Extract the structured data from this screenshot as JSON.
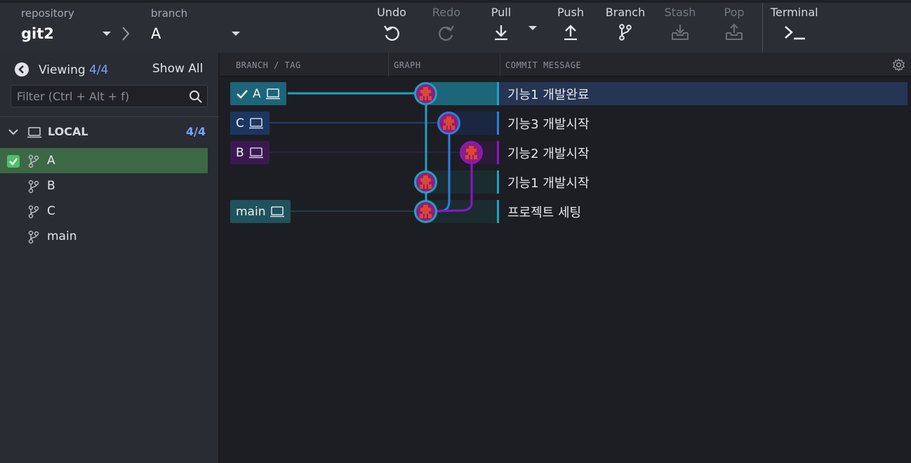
{
  "toolbar": {
    "repository_caption": "repository",
    "repository_name": "git2",
    "branch_caption": "branch",
    "branch_name": "A",
    "buttons": {
      "undo": "Undo",
      "redo": "Redo",
      "pull": "Pull",
      "push": "Push",
      "branch": "Branch",
      "stash": "Stash",
      "pop": "Pop",
      "terminal": "Terminal"
    }
  },
  "left_panel": {
    "viewing_label": "Viewing",
    "viewing_count": "4/4",
    "show_all": "Show All",
    "filter_placeholder": "Filter (Ctrl + Alt + f)",
    "local_label": "LOCAL",
    "local_count": "4/4",
    "branches": [
      {
        "name": "A",
        "checked_out": true
      },
      {
        "name": "B",
        "checked_out": false
      },
      {
        "name": "C",
        "checked_out": false
      },
      {
        "name": "main",
        "checked_out": false
      }
    ]
  },
  "graph": {
    "columns": {
      "branch_tag": "BRANCH / TAG",
      "graph": "GRAPH",
      "commit_message": "COMMIT MESSAGE"
    },
    "commits": [
      {
        "message": "기능1 개발완료",
        "ref": "A",
        "checked_out": true,
        "lane": 0,
        "color": "#1fa0c6",
        "selected": true
      },
      {
        "message": "기능3 개발시작",
        "ref": "C",
        "checked_out": false,
        "lane": 1,
        "color": "#2a7fe0",
        "selected": false
      },
      {
        "message": "기능2 개발시작",
        "ref": "B",
        "checked_out": false,
        "lane": 2,
        "color": "#8e14c9",
        "selected": false
      },
      {
        "message": "기능1 개발시작",
        "ref": "",
        "checked_out": false,
        "lane": 0,
        "color": "#1fa0c6",
        "selected": false
      },
      {
        "message": "프로젝트 세팅",
        "ref": "main",
        "checked_out": false,
        "lane": 0,
        "color": "#1fa0c6",
        "selected": false
      }
    ]
  },
  "colors": {
    "accent_blue": "#7aa2ff",
    "lane_cyan": "#1fa0c6",
    "lane_blue": "#2a7fe0",
    "lane_purple": "#8e14c9",
    "active_branch_bg": "#3c6845",
    "selected_row_bg": "#263554"
  }
}
